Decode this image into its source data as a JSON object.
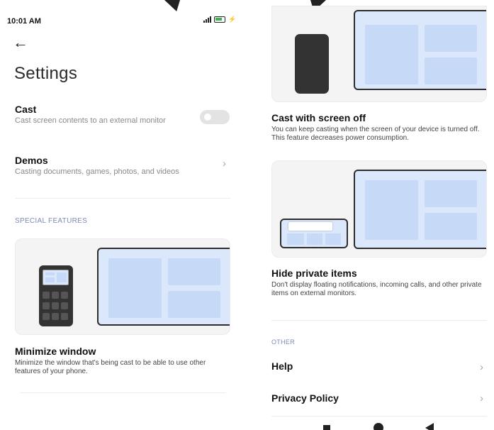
{
  "status_bar": {
    "time": "10:01 AM"
  },
  "header": {
    "title": "Settings"
  },
  "cast": {
    "title": "Cast",
    "subtitle": "Cast screen contents to an external monitor",
    "enabled": false
  },
  "demos": {
    "title": "Demos",
    "subtitle": "Casting documents, games, photos, and videos"
  },
  "special_features": {
    "label": "SPECIAL FEATURES",
    "items": [
      {
        "title": "Minimize window",
        "description": "Minimize the window that's being cast to be able to use other features of your phone."
      },
      {
        "title": "Cast with screen off",
        "description": "You can keep casting when the screen of your device is turned off. This feature decreases power consumption."
      },
      {
        "title": "Hide private items",
        "description": "Don't display floating notifications, incoming calls, and other private items on external monitors."
      }
    ]
  },
  "other": {
    "label": "OTHER",
    "items": [
      {
        "label": "Help"
      },
      {
        "label": "Privacy Policy"
      }
    ]
  },
  "icons": {
    "back": "arrow-left-icon",
    "chevron": "chevron-right-icon",
    "nav": [
      "recents-square-icon",
      "home-circle-icon",
      "back-triangle-icon"
    ]
  },
  "colors": {
    "section_label": "#7d8bb6",
    "illustration_fill": "#dbe8fb",
    "illustration_pane": "#c6d9f6",
    "toggle_off": "#e3e3e3"
  }
}
